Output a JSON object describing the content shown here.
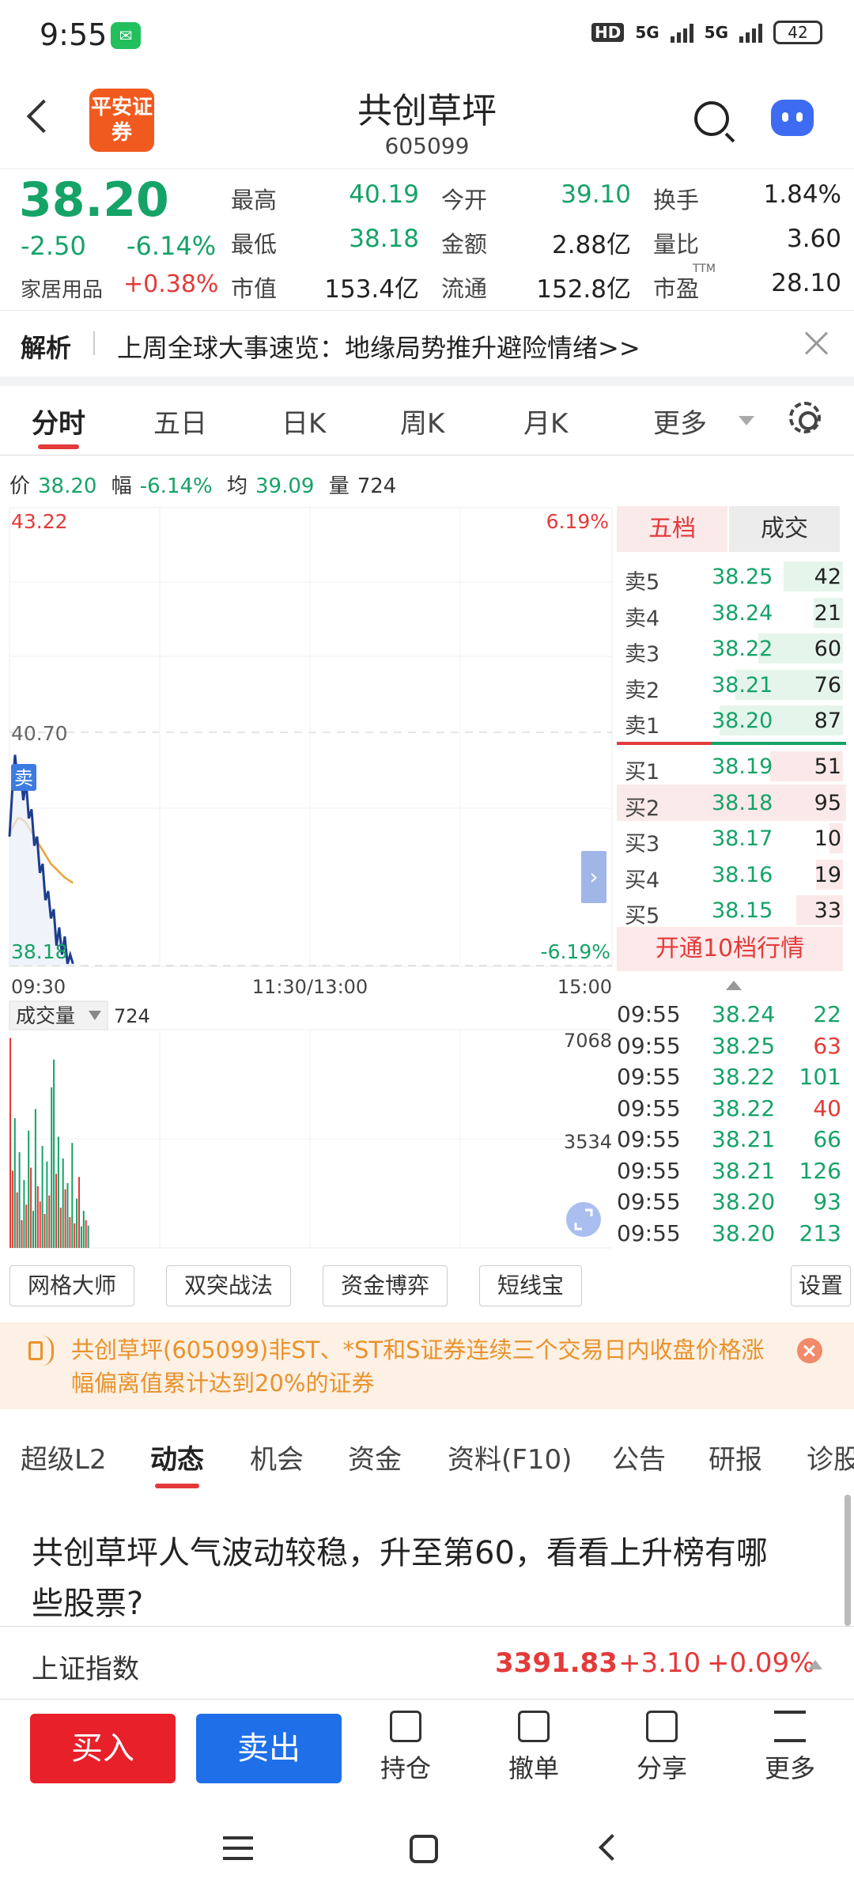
{
  "status_bar": {
    "time": "9:55",
    "battery": "42",
    "net1": "5G",
    "net2": "5G",
    "hd": "HD"
  },
  "header": {
    "logo": "平安证券",
    "title": "共创草坪",
    "code": "605099"
  },
  "quote": {
    "price": "38.20",
    "change": "-2.50",
    "change_pct": "-6.14%",
    "sector": "家居用品",
    "sector_pct": "+0.38%",
    "stats": [
      {
        "label": "最高",
        "value": "40.19",
        "color": "green"
      },
      {
        "label": "今开",
        "value": "39.10",
        "color": "green"
      },
      {
        "label": "换手",
        "value": "1.84%",
        "color": "black"
      },
      {
        "label": "最低",
        "value": "38.18",
        "color": "green"
      },
      {
        "label": "金额",
        "value": "2.88亿",
        "color": "black"
      },
      {
        "label": "量比",
        "value": "3.60",
        "color": "black"
      },
      {
        "label": "市值",
        "value": "153.4亿",
        "color": "black"
      },
      {
        "label": "流通",
        "value": "152.8亿",
        "color": "black"
      },
      {
        "label": "市盈",
        "value": "28.10",
        "color": "black",
        "sup": "TTM"
      }
    ]
  },
  "news": {
    "tag": "解析",
    "text": "上周全球大事速览：地缘局势推升避险情绪>>"
  },
  "chart_tabs": [
    "分时",
    "五日",
    "日K",
    "周K",
    "月K",
    "更多"
  ],
  "info_line": {
    "price_label": "价",
    "price": "38.20",
    "amp_label": "幅",
    "amp": "-6.14%",
    "avg_label": "均",
    "avg": "39.09",
    "vol_label": "量",
    "vol": "724"
  },
  "chart_data": {
    "type": "line",
    "y_max_label": "43.22",
    "y_max_pct": "6.19%",
    "y_mid_label": "40.70",
    "y_min_label": "38.18",
    "y_min_pct": "-6.19%",
    "x_ticks": [
      "09:30",
      "11:30/13:00",
      "15:00"
    ],
    "ylim": [
      38.18,
      43.22
    ],
    "sell_marker": "卖",
    "series": [
      {
        "values": [
          39.6,
          40.1,
          40.5,
          40.19,
          40.3,
          40.0,
          40.2,
          39.8,
          39.9,
          39.5,
          39.6,
          39.2,
          39.3,
          38.9,
          39.0,
          38.7,
          38.8,
          38.4,
          38.6,
          38.3,
          38.5,
          38.2,
          38.3,
          38.2
        ]
      },
      {
        "values": [
          39.6,
          39.7,
          39.75,
          39.8,
          39.8,
          39.78,
          39.75,
          39.7,
          39.65,
          39.6,
          39.55,
          39.5,
          39.45,
          39.4,
          39.35,
          39.3,
          39.27,
          39.24,
          39.21,
          39.18,
          39.15,
          39.13,
          39.11,
          39.09
        ]
      }
    ],
    "volume": {
      "label": "成交量",
      "current": "724",
      "max_label": "7068",
      "mid_label": "3534",
      "bars": [
        6800,
        2500,
        4200,
        1800,
        3100,
        900,
        2200,
        1400,
        3800,
        2600,
        1200,
        4500,
        2000,
        1500,
        3300,
        1100,
        2800,
        1700,
        5200,
        6100,
        2400,
        3600,
        1300,
        2900,
        1900,
        2100,
        1000,
        3400,
        800,
        1600,
        2300,
        700,
        1200,
        900,
        724
      ],
      "colors": [
        "red",
        "red",
        "green",
        "red",
        "green",
        "red",
        "green",
        "red",
        "green",
        "red",
        "green",
        "green",
        "red",
        "red",
        "green",
        "red",
        "green",
        "red",
        "green",
        "green",
        "red",
        "green",
        "red",
        "green",
        "red",
        "green",
        "red",
        "green",
        "red",
        "green",
        "red",
        "green",
        "green",
        "red",
        "green"
      ]
    }
  },
  "order_book": {
    "tabs": [
      "五档",
      "成交"
    ],
    "asks": [
      {
        "label": "卖5",
        "price": "38.25",
        "vol": "42",
        "ratio": 0.44
      },
      {
        "label": "卖4",
        "price": "38.24",
        "vol": "21",
        "ratio": 0.22
      },
      {
        "label": "卖3",
        "price": "38.22",
        "vol": "60",
        "ratio": 0.63
      },
      {
        "label": "卖2",
        "price": "38.21",
        "vol": "76",
        "ratio": 0.8
      },
      {
        "label": "卖1",
        "price": "38.20",
        "vol": "87",
        "ratio": 0.92
      }
    ],
    "bids": [
      {
        "label": "买1",
        "price": "38.19",
        "vol": "51",
        "ratio": 0.54
      },
      {
        "label": "买2",
        "price": "38.18",
        "vol": "95",
        "ratio": 1.0
      },
      {
        "label": "买3",
        "price": "38.17",
        "vol": "10",
        "ratio": 0.1
      },
      {
        "label": "买4",
        "price": "38.16",
        "vol": "19",
        "ratio": 0.2
      },
      {
        "label": "买5",
        "price": "38.15",
        "vol": "33",
        "ratio": 0.35
      }
    ],
    "upgrade": "开通10档行情"
  },
  "trades": [
    {
      "time": "09:55",
      "price": "38.24",
      "vol": "22",
      "color": "green"
    },
    {
      "time": "09:55",
      "price": "38.25",
      "vol": "63",
      "color": "red"
    },
    {
      "time": "09:55",
      "price": "38.22",
      "vol": "101",
      "color": "green"
    },
    {
      "time": "09:55",
      "price": "38.22",
      "vol": "40",
      "color": "red"
    },
    {
      "time": "09:55",
      "price": "38.21",
      "vol": "66",
      "color": "green"
    },
    {
      "time": "09:55",
      "price": "38.21",
      "vol": "126",
      "color": "green"
    },
    {
      "time": "09:55",
      "price": "38.20",
      "vol": "93",
      "color": "green"
    },
    {
      "time": "09:55",
      "price": "38.20",
      "vol": "213",
      "color": "green"
    }
  ],
  "tools": [
    "网格大师",
    "双突战法",
    "资金博弈",
    "短线宝",
    "设置"
  ],
  "notice": "共创草坪(605099)非ST、*ST和S证券连续三个交易日内收盘价格涨幅偏离值累计达到20%的证券",
  "bottom_tabs": [
    "超级L2",
    "动态",
    "机会",
    "资金",
    "资料(F10)",
    "公告",
    "研报",
    "诊股"
  ],
  "article_title": "共创草坪人气波动较稳，升至第60，看看上升榜有哪些股票?",
  "index": {
    "name": "上证指数",
    "value": "3391.83",
    "change": "+3.10",
    "pct": "+0.09%"
  },
  "actions": {
    "buy": "买入",
    "sell": "卖出",
    "items": [
      "持仓",
      "撤单",
      "分享",
      "更多"
    ]
  },
  "colors": {
    "red": "#e33a3a",
    "green": "#15a367",
    "blue": "#1f6fe8",
    "line": "#1d3d8f",
    "avg": "#e8a33a"
  }
}
